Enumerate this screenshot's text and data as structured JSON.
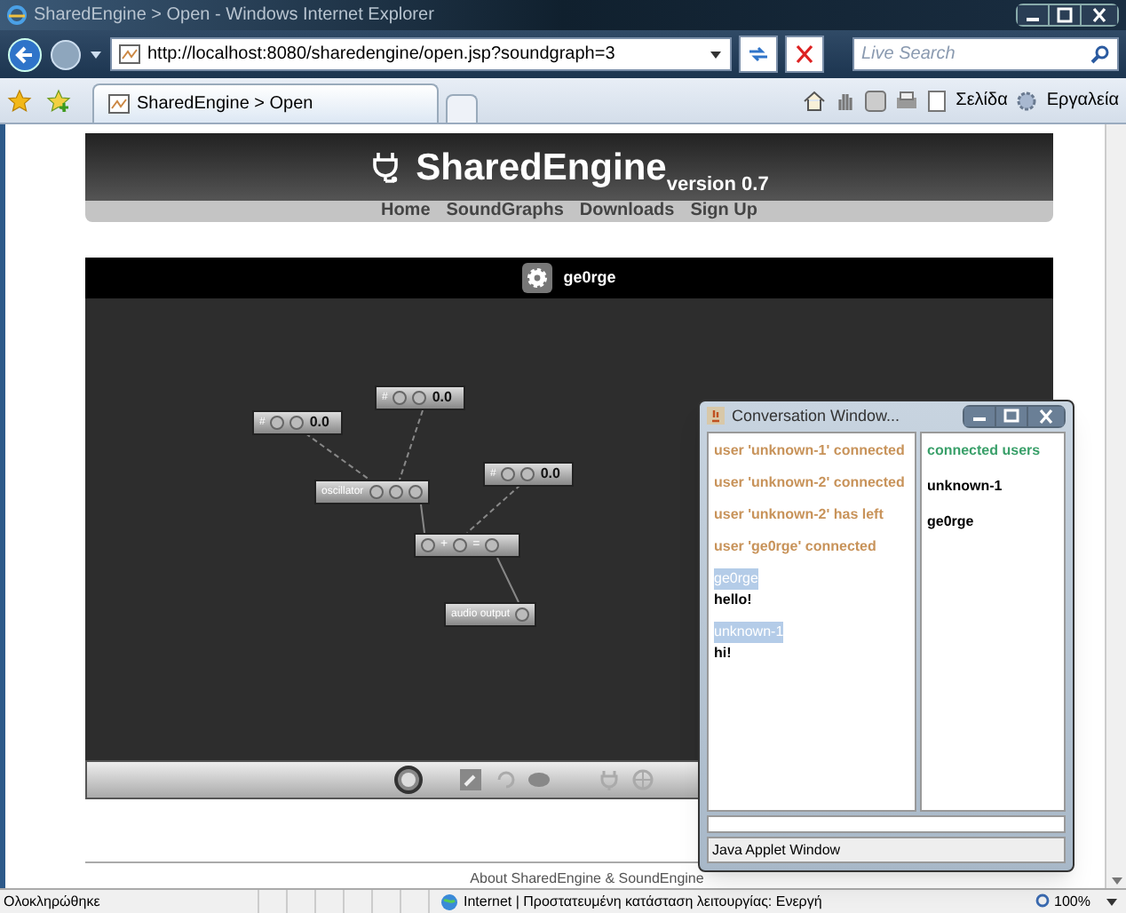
{
  "browser": {
    "title": "SharedEngine > Open - Windows Internet Explorer",
    "url": "http://localhost:8080/sharedengine/open.jsp?soundgraph=3",
    "search_placeholder": "Live Search",
    "tab": "SharedEngine > Open",
    "commands": [
      "Σελίδα",
      "Εργαλεία"
    ]
  },
  "site": {
    "logo": "SharedEngine",
    "version": "version 0.7",
    "nav": [
      "Home",
      "SoundGraphs",
      "Downloads",
      "Sign Up"
    ],
    "footer": "About SharedEngine & SoundEngine"
  },
  "editor": {
    "user": "ge0rge",
    "nodes": [
      {
        "kind": "number",
        "label": "#",
        "value": "0.0"
      },
      {
        "kind": "number",
        "label": "#",
        "value": "0.0"
      },
      {
        "kind": "number",
        "label": "#",
        "value": "0.0"
      },
      {
        "kind": "named",
        "label": "oscillator"
      },
      {
        "kind": "mixer",
        "plus": "+",
        "equals": "="
      },
      {
        "kind": "output",
        "label": "audio output"
      }
    ]
  },
  "conversation": {
    "title": "Conversation Window...",
    "log": [
      {
        "kind": "event",
        "text": "user 'unknown-1' connected"
      },
      {
        "kind": "event",
        "text": "user 'unknown-2' connected"
      },
      {
        "kind": "event",
        "text": "user 'unknown-2' has left"
      },
      {
        "kind": "event",
        "text": "user 'ge0rge' connected"
      },
      {
        "kind": "message",
        "author": "ge0rge",
        "text": "hello!"
      },
      {
        "kind": "message",
        "author": "unknown-1",
        "text": "hi!"
      }
    ],
    "users_header": "connected users",
    "users": [
      "unknown-1",
      "ge0rge"
    ],
    "footer": "Java Applet Window"
  },
  "status_bar": {
    "status": "Ολοκληρώθηκε",
    "zone": "Internet | Προστατευμένη κατάσταση λειτουργίας: Ενεργή",
    "zoom": "100%"
  }
}
